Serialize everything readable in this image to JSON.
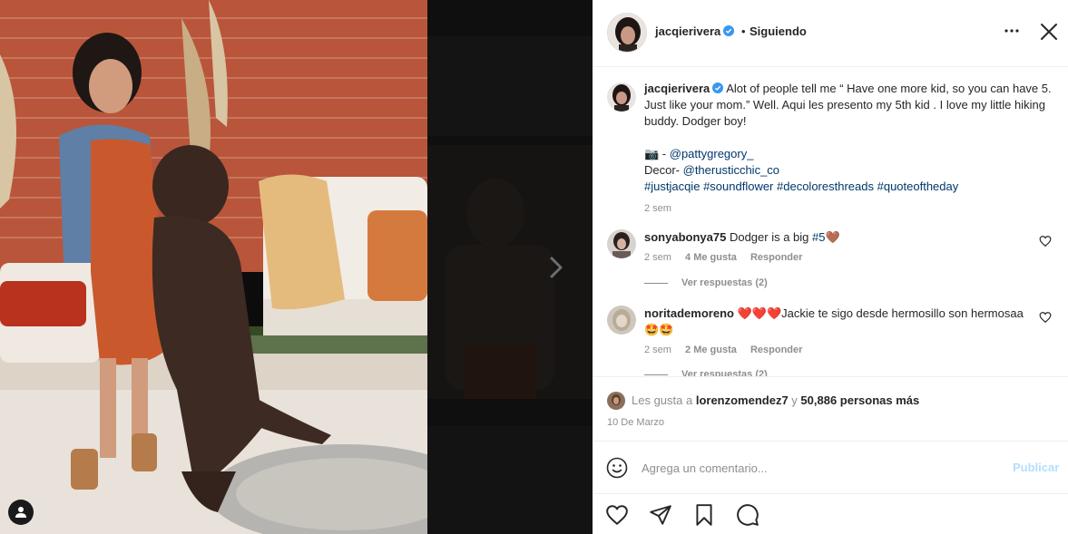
{
  "post": {
    "photo_alt": "Woman in denim jacket and orange dress with standing brown dog",
    "next_icon": "chevron-right-icon",
    "user_tag_icon": "person-icon"
  },
  "header": {
    "username": "jacqierivera",
    "separator": "•",
    "follow_status": "Siguiendo",
    "more_icon": "more-horizontal-icon",
    "close_icon": "close-icon"
  },
  "caption": {
    "username": "jacqierivera",
    "text": "Alot of people tell me “ Have one more kid, so you can have 5. Just like your mom.” Well. Aqui les presento my 5th kid . I love my little hiking buddy. Dodger boy!",
    "camera_emoji": "📷",
    "photo_credit_prefix": " - ",
    "photo_credit": "@pattygregory_",
    "decor_prefix": "Decor- ",
    "decor_credit": "@therusticchic_co",
    "hashtags": [
      "#justjacqie",
      "#soundflower",
      "#decoloresthreads",
      "#quoteoftheday"
    ],
    "time": "2 sem"
  },
  "comments": [
    {
      "username": "sonyabonya75",
      "text_before": "Dodger is a big ",
      "hashtag": "#5",
      "emoji": "🤎",
      "time": "2 sem",
      "likes": "4 Me gusta",
      "reply": "Responder",
      "view_replies": "Ver respuestas (2)"
    },
    {
      "username": "noritademoreno",
      "hearts": "❤️❤️❤️",
      "text": "Jackie te sigo desde hermosillo son hermosaa",
      "emoji": "🤩🤩",
      "time": "2 sem",
      "likes": "2 Me gusta",
      "reply": "Responder",
      "view_replies": "Ver respuestas (2)"
    }
  ],
  "likes": {
    "prefix": "Les gusta a ",
    "user": "lorenzomendez7",
    "middle": " y ",
    "count": "50,886 personas más"
  },
  "date": "10 De Marzo",
  "add_comment": {
    "placeholder": "Agrega un comentario...",
    "publish_label": "Publicar"
  },
  "colors": {
    "link": "#00376b",
    "muted": "#8e8e8e",
    "publish_disabled": "#b2dffc",
    "verified": "#3897f0"
  }
}
